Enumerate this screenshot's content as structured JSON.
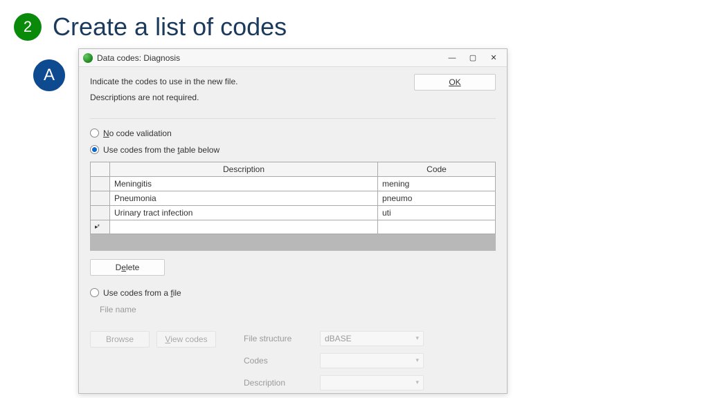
{
  "step": {
    "number": "2",
    "title": "Create a list of codes",
    "sub_letter": "A"
  },
  "dialog": {
    "title": "Data codes:  Diagnosis",
    "instruction1": "Indicate the codes to use in the new file.",
    "instruction2": "Descriptions are not required.",
    "ok_label": "OK",
    "radio_no_validation": "No code validation",
    "radio_table": "Use codes from the table below",
    "radio_file": "Use codes from a file",
    "table": {
      "col_desc": "Description",
      "col_code": "Code",
      "rows": [
        {
          "desc": "Meningitis",
          "code": "mening"
        },
        {
          "desc": "Pneumonia",
          "code": "pneumo"
        },
        {
          "desc": "Urinary tract infection",
          "code": "uti"
        }
      ],
      "new_row_marker": "▸*"
    },
    "delete_label": "Delete",
    "file_name_label": "File name",
    "browse_label": "Browse",
    "view_codes_label": "View codes",
    "field_structure": "File structure",
    "field_codes": "Codes",
    "field_description": "Description",
    "structure_value": "dBASE"
  }
}
